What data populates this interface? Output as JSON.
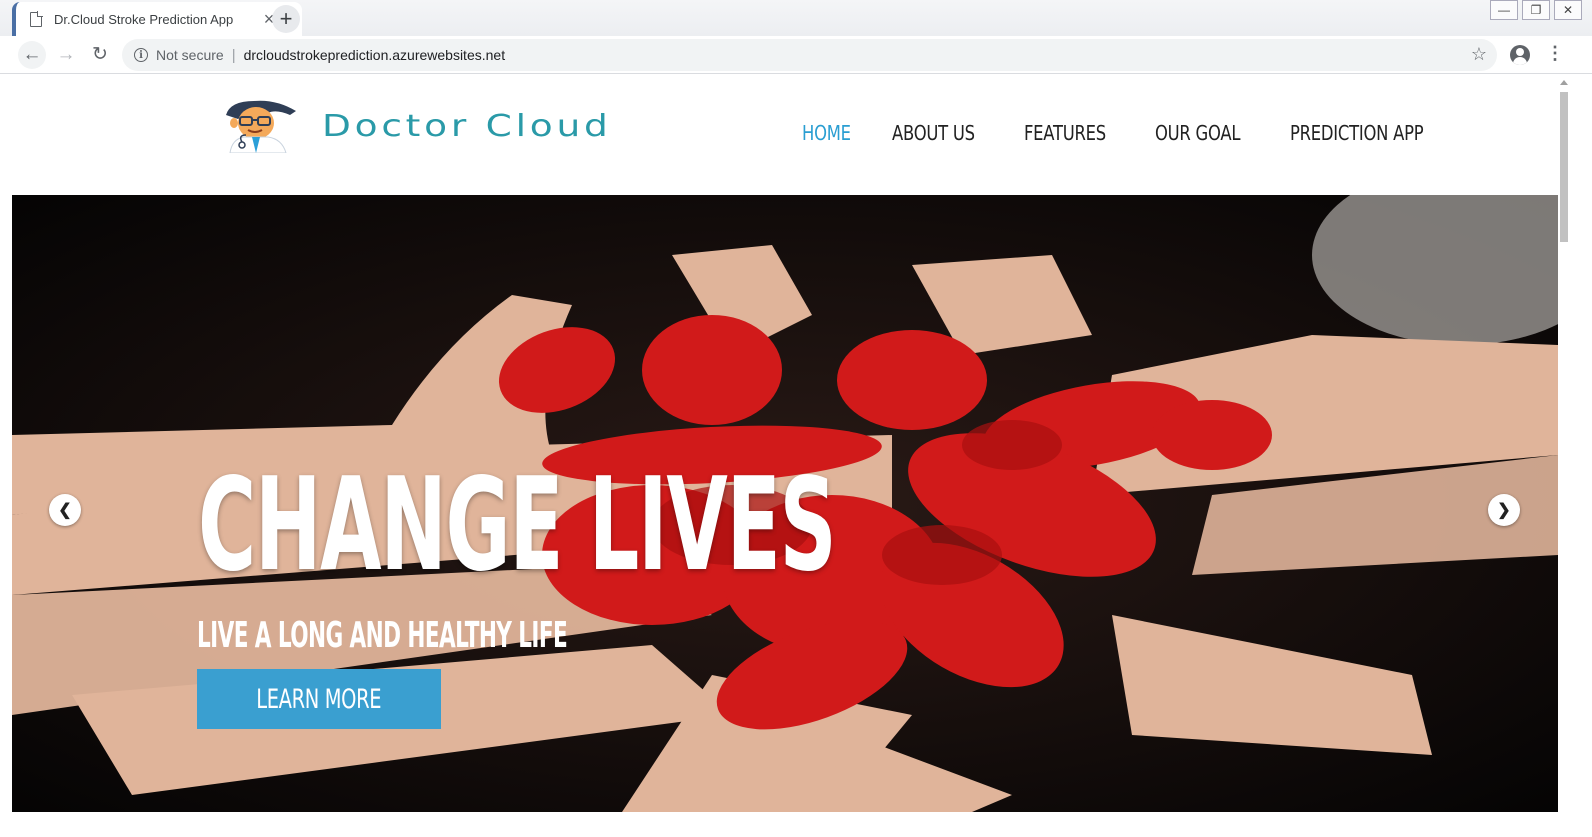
{
  "browser": {
    "tab_title": "Dr.Cloud Stroke Prediction App",
    "tab_close": "×",
    "new_tab": "+",
    "security_label": "Not secure",
    "url_separator": "|",
    "url": "drcloudstrokeprediction.azurewebsites.net",
    "window_controls": [
      "—",
      "❐",
      "✕"
    ]
  },
  "site": {
    "logo_text": "Doctor Cloud",
    "nav": [
      {
        "label": "HOME",
        "active": true
      },
      {
        "label": "ABOUT US",
        "active": false
      },
      {
        "label": "FEATURES",
        "active": false
      },
      {
        "label": "OUR GOAL",
        "active": false
      },
      {
        "label": "PREDICTION APP",
        "active": false
      }
    ],
    "accent_color": "#2a9ed2",
    "logo_color": "#2a9aa8"
  },
  "hero": {
    "title": "CHANGE LIVES",
    "subtitle": "LIVE A LONG AND HEALTHY LIFE",
    "cta_label": "LEARN MORE",
    "cta_color": "#3a9fd0",
    "background_description_icon": "painted-hands-heart-image"
  }
}
